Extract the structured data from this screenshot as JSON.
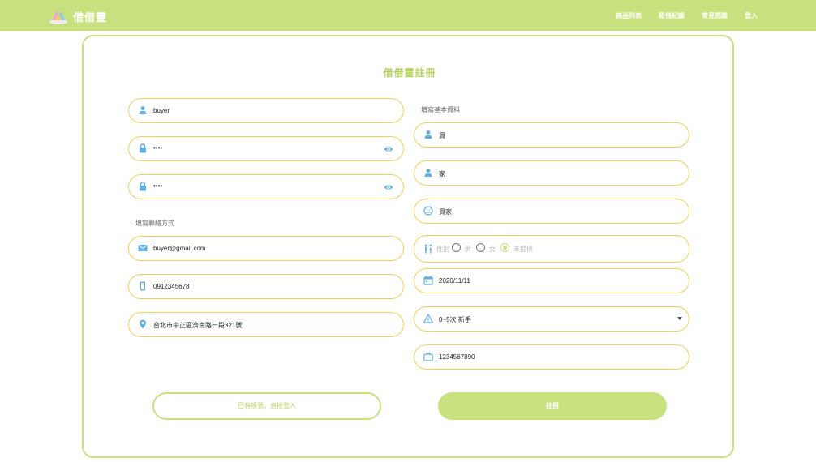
{
  "header": {
    "brand": "借借靈",
    "nav": [
      "商品列表",
      "租借紀錄",
      "常見問題",
      "登入"
    ]
  },
  "form": {
    "title": "借借靈註冊",
    "username": "buyer",
    "password": "••••",
    "confirm_password": "••••",
    "contact_section_label": "填寫聯絡方式",
    "email": "buyer@gmail.com",
    "phone": "0912345678",
    "address": "台北市中正區濟南路一段321號",
    "basic_section_label": "填寫基本資料",
    "last_name": "買",
    "first_name": "家",
    "nickname": "買家",
    "gender_label": "性別",
    "gender_options": [
      "男",
      "女",
      "未提供"
    ],
    "gender_selected": "未提供",
    "birthday": "2020/11/11",
    "experience": "0~5次 新手",
    "bank_account": "1234567890",
    "login_button": "已有帳號，直接登入",
    "register_button": "註冊"
  },
  "colors": {
    "primary_green": "#c8e17f",
    "field_border": "#f2cf56",
    "icon_blue": "#5fb0e6"
  }
}
